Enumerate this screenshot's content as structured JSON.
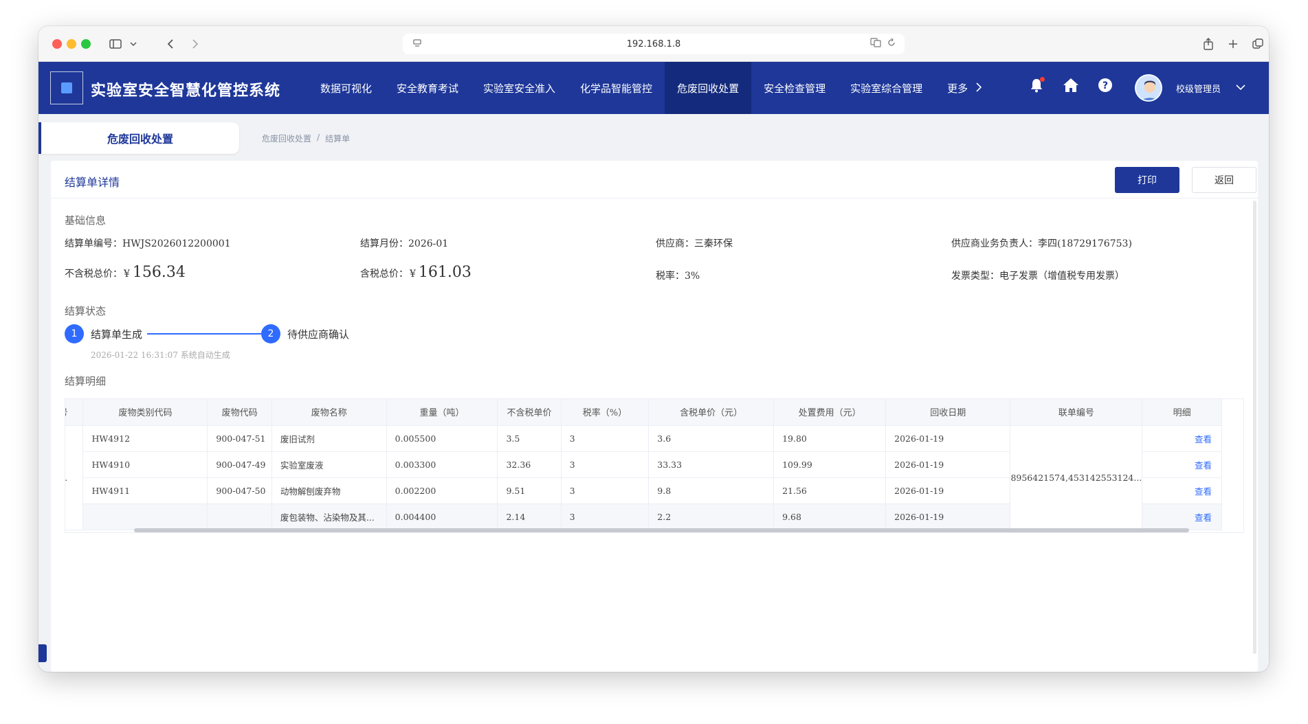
{
  "browser": {
    "url": "192.168.1.8"
  },
  "header": {
    "title": "实验室安全智慧化管控系统",
    "nav": [
      {
        "label": "数据可视化"
      },
      {
        "label": "安全教育考试"
      },
      {
        "label": "实验室安全准入"
      },
      {
        "label": "化学品智能管控"
      },
      {
        "label": "危废回收处置",
        "active": true
      },
      {
        "label": "安全检查管理"
      },
      {
        "label": "实验室综合管理"
      },
      {
        "label": "更多"
      }
    ],
    "user_name": "校级管理员",
    "accent_color": "#1e3799",
    "active_color": "#142b7d"
  },
  "page_tab": "危废回收处置",
  "breadcrumb": [
    "危废回收处置",
    "/",
    "结算单"
  ],
  "card": {
    "title": "结算单详情",
    "print_label": "打印",
    "back_label": "返回"
  },
  "basic": {
    "section": "基础信息",
    "no_label": "结算单编号：",
    "no_value": "HWJS2026012200001",
    "month_label": "结算月份：",
    "month_value": "2026-01",
    "supplier_label": "供应商：",
    "supplier_value": "三秦环保",
    "contact_label": "供应商业务负责人：",
    "contact_value": "李四(18729176753)",
    "pretax_label": "不含税总价：",
    "pretax_currency": "¥",
    "pretax_value": "156.34",
    "taxed_label": "含税总价：",
    "taxed_currency": "¥",
    "taxed_value": "161.03",
    "rate_label": "税率：",
    "rate_value": "3%",
    "invoice_label": "发票类型：",
    "invoice_value": "电子发票（增值税专用发票）"
  },
  "status": {
    "section": "结算状态",
    "steps": [
      {
        "num": "1",
        "label": "结算单生成",
        "note": "2026-01-22 16:31:07 系统自动生成"
      },
      {
        "num": "2",
        "label": "待供应商确认"
      }
    ],
    "step_color": "#2f6bff"
  },
  "detail": {
    "section": "结算明细",
    "columns": [
      "号",
      "废物类别代码",
      "废物代码",
      "废物名称",
      "重量（吨）",
      "不含税单价",
      "税率（%）",
      "含税单价（元）",
      "处置费用（元）",
      "回收日期",
      "联单编号",
      "明细"
    ],
    "merged_index": "...",
    "merged_manifest": "8956421574,453142553124...",
    "rows": [
      {
        "category": "HW4912",
        "code": "900-047-51",
        "name": "废旧试剂",
        "weight": "0.005500",
        "price": "3.5",
        "rate": "3",
        "taxed_price": "3.6",
        "fee": "19.80",
        "date": "2026-01-19",
        "action": "查看"
      },
      {
        "category": "HW4910",
        "code": "900-047-49",
        "name": "实验室废液",
        "weight": "0.003300",
        "price": "32.36",
        "rate": "3",
        "taxed_price": "33.33",
        "fee": "109.99",
        "date": "2026-01-19",
        "action": "查看"
      },
      {
        "category": "HW4911",
        "code": "900-047-50",
        "name": "动物解刨废弃物",
        "weight": "0.002200",
        "price": "9.51",
        "rate": "3",
        "taxed_price": "9.8",
        "fee": "21.56",
        "date": "2026-01-19",
        "action": "查看"
      },
      {
        "category": "",
        "code": "",
        "name": "废包装物、沾染物及其...",
        "weight": "0.004400",
        "price": "2.14",
        "rate": "3",
        "taxed_price": "2.2",
        "fee": "9.68",
        "date": "2026-01-19",
        "action": "查看"
      }
    ]
  }
}
